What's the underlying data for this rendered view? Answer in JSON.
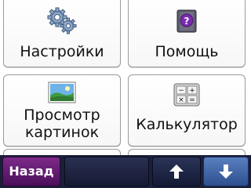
{
  "menu": {
    "items": [
      {
        "label": "Настройки",
        "icon": "settings-gears-icon"
      },
      {
        "label": "Помощь",
        "icon": "help-question-icon"
      },
      {
        "label": "Просмотр\nкартинок",
        "icon": "picture-viewer-icon"
      },
      {
        "label": "Калькулятор",
        "icon": "calculator-icon"
      }
    ]
  },
  "toolbar": {
    "back_label": "Назад",
    "up_icon": "arrow-up-icon",
    "down_icon": "arrow-down-icon"
  },
  "colors": {
    "toolbar_bg": "#1a1f3a",
    "back_button": "#6a1f78",
    "down_button": "#3f68ad"
  }
}
